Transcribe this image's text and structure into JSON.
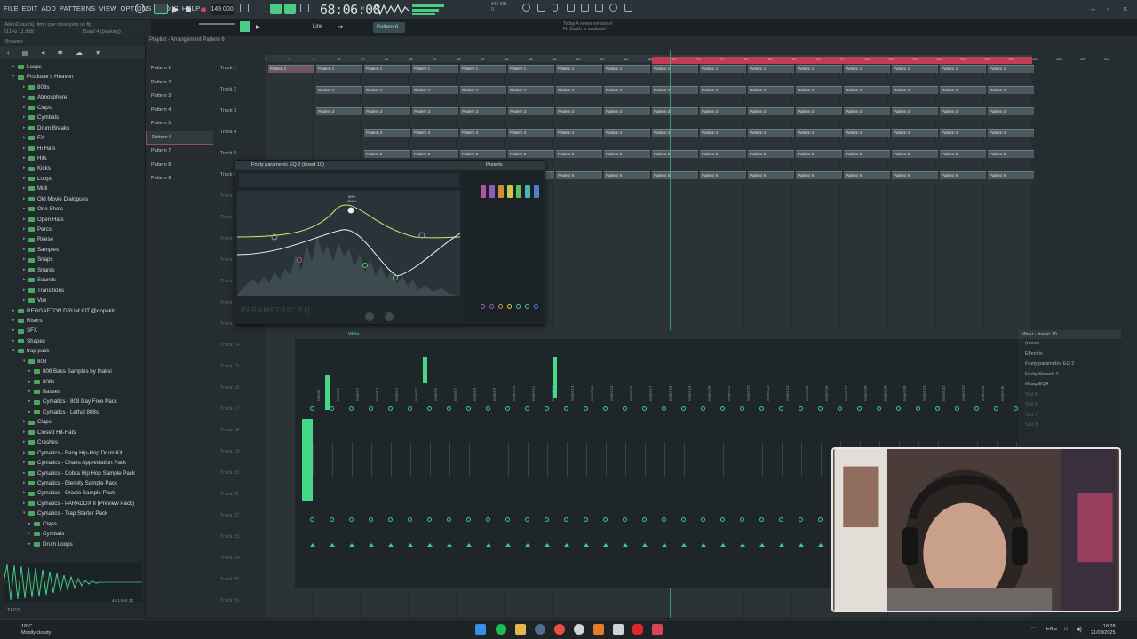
{
  "menu": [
    "FILE",
    "EDIT",
    "ADD",
    "PATTERNS",
    "VIEW",
    "OPTIONS",
    "TOOLS",
    "HELP"
  ],
  "info": {
    "line1": "[AlienCloud/a] ritmo que nose pero se flp",
    "line2": "611Hz 11.9dB",
    "peak": "Band 4 (peaking)"
  },
  "transport": {
    "tempo": "149.000",
    "song_time": "68:06:08",
    "song_time_label": "M:S:CS",
    "cpu_line1": "342 MB",
    "cpu_line2": "0"
  },
  "news": {
    "line1": "Today  A newer version of",
    "line2": "FL Studio is available!"
  },
  "toolbar2": {
    "mode": "Line",
    "pattern": "Pattern 6"
  },
  "browser": {
    "title": "Browser",
    "items": [
      {
        "label": "Loops",
        "level": 0
      },
      {
        "label": "Producer's Heaven",
        "level": 0,
        "open": true
      },
      {
        "label": "808s",
        "level": 1
      },
      {
        "label": "Atmosphere",
        "level": 1
      },
      {
        "label": "Claps",
        "level": 1
      },
      {
        "label": "Cymbals",
        "level": 1
      },
      {
        "label": "Drum Breaks",
        "level": 1
      },
      {
        "label": "FX",
        "level": 1
      },
      {
        "label": "Hi Hats",
        "level": 1
      },
      {
        "label": "Hits",
        "level": 1
      },
      {
        "label": "Kicks",
        "level": 1
      },
      {
        "label": "Loops",
        "level": 1
      },
      {
        "label": "Midi",
        "level": 1
      },
      {
        "label": "Old Movie Dialogues",
        "level": 1
      },
      {
        "label": "One Shots",
        "level": 1
      },
      {
        "label": "Open Hats",
        "level": 1
      },
      {
        "label": "Percs",
        "level": 1
      },
      {
        "label": "Reese",
        "level": 1
      },
      {
        "label": "Samples",
        "level": 1
      },
      {
        "label": "Snaps",
        "level": 1
      },
      {
        "label": "Snares",
        "level": 1
      },
      {
        "label": "Sounds",
        "level": 1
      },
      {
        "label": "Transitions",
        "level": 1
      },
      {
        "label": "Vox",
        "level": 1
      },
      {
        "label": "REGGAETON DRUM KIT @dopekit",
        "level": 0
      },
      {
        "label": "Risers",
        "level": 0
      },
      {
        "label": "SFX",
        "level": 0
      },
      {
        "label": "Shapes",
        "level": 0
      },
      {
        "label": "trap pack",
        "level": 0,
        "open": true
      },
      {
        "label": "808",
        "level": 1,
        "open": true
      },
      {
        "label": "808 Bass Samples by Ihaksi",
        "level": 2
      },
      {
        "label": "808s",
        "level": 2
      },
      {
        "label": "Basses",
        "level": 2
      },
      {
        "label": "Cymatics - 808 Day Free Pack",
        "level": 2
      },
      {
        "label": "Cymatics - Lethal 808s",
        "level": 2
      },
      {
        "label": "Claps",
        "level": 1
      },
      {
        "label": "Closed Hit-Hats",
        "level": 1
      },
      {
        "label": "Crashes",
        "level": 1
      },
      {
        "label": "Cymatics - Bang Hip-Hop Drum Kit",
        "level": 1
      },
      {
        "label": "Cymatics - Chaos Appreciation Pack",
        "level": 1
      },
      {
        "label": "Cymatics - Cobra Hip Hop Sample Pack",
        "level": 1
      },
      {
        "label": "Cymatics - Eternity Sample Pack",
        "level": 1
      },
      {
        "label": "Cymatics - Oracle Sample Pack",
        "level": 1
      },
      {
        "label": "Cymatics - PARADOX II (Preview Pack)",
        "level": 1
      },
      {
        "label": "Cymatics - Trap Starter Pack",
        "level": 1,
        "open": true
      },
      {
        "label": "Claps",
        "level": 2
      },
      {
        "label": "Cymbals",
        "level": 2
      },
      {
        "label": "Drum Loops",
        "level": 2
      }
    ],
    "sample_info": "44.1 kHz 32",
    "tags": "TAGS"
  },
  "playlist": {
    "title": "Playlist - Arrangement",
    "current": "Pattern 6",
    "patterns": [
      "Pattern 1",
      "Pattern 2",
      "Pattern 3",
      "Pattern 4",
      "Pattern 5",
      "Pattern 6",
      "Pattern 7",
      "Pattern 8",
      "Pattern 9"
    ],
    "selected_pattern": 5,
    "tracks": [
      "Track 1",
      "Track 2",
      "Track 3",
      "Track 4",
      "Track 5",
      "Track 6",
      "Track 7",
      "Track 8",
      "Track 9",
      "Track 10",
      "Track 11",
      "Track 12",
      "Track 13",
      "Track 14",
      "Track 15",
      "Track 16",
      "Track 17",
      "Track 18",
      "Track 19",
      "Track 20",
      "Track 21",
      "Track 22",
      "Track 23",
      "Track 24",
      "Track 25",
      "Track 26"
    ],
    "ruler": [
      "1",
      "5",
      "9",
      "13",
      "17",
      "21",
      "25",
      "29",
      "33",
      "37",
      "41",
      "45",
      "49",
      "53",
      "57",
      "61",
      "65",
      "69",
      "73",
      "77",
      "81",
      "85",
      "89",
      "93",
      "97",
      "101",
      "105",
      "109",
      "113",
      "117",
      "121",
      "125",
      "129",
      "133",
      "137",
      "141"
    ]
  },
  "eq": {
    "title": "Fruity parametric EQ 2 (Insert 10)",
    "presets": "Presets",
    "logo": "PARAMETRIC EQ",
    "band_label_1": "89%",
    "band_label_2": "324%"
  },
  "mixer": {
    "title": "Wide",
    "insert_title": "Mixer - Insert 10",
    "slot_header": "(none)",
    "slots": [
      "Effectrix",
      "Fruity parametric EQ 2",
      "Fruity Reverb 2",
      "Maag EQ4",
      "Slot 5",
      "Slot 6",
      "Slot 7",
      "Slot 8"
    ],
    "strips": [
      "Master",
      "Insert 1",
      "Insert 2",
      "Insert 3",
      "Insert 4",
      "Insert 5",
      "Insert 6",
      "Insert 7",
      "Insert 8",
      "Insert 9",
      "Insert 10",
      "Insert 11",
      "Insert 12",
      "Insert 13",
      "Insert 14",
      "Insert 15",
      "Insert 16",
      "Insert 17",
      "Insert 18",
      "Insert 19",
      "Insert 20",
      "Insert 21",
      "Insert 22",
      "Insert 23",
      "Insert 24",
      "Insert 25",
      "Insert 26",
      "Insert 27",
      "Insert 28",
      "Insert 29",
      "Insert 30",
      "Insert 31",
      "Insert 32",
      "Insert 33",
      "Insert 34",
      "Insert 35",
      "Insert 36"
    ],
    "marker": "10"
  },
  "taskbar": {
    "temp": "18°C",
    "weather": "Mostly cloudy",
    "lang": "ENG",
    "time": "18:28",
    "date": "21/08/2025"
  },
  "colors": {
    "accent": "#3fc585",
    "loop": "#c33b54",
    "clip": "#4b5a61"
  }
}
